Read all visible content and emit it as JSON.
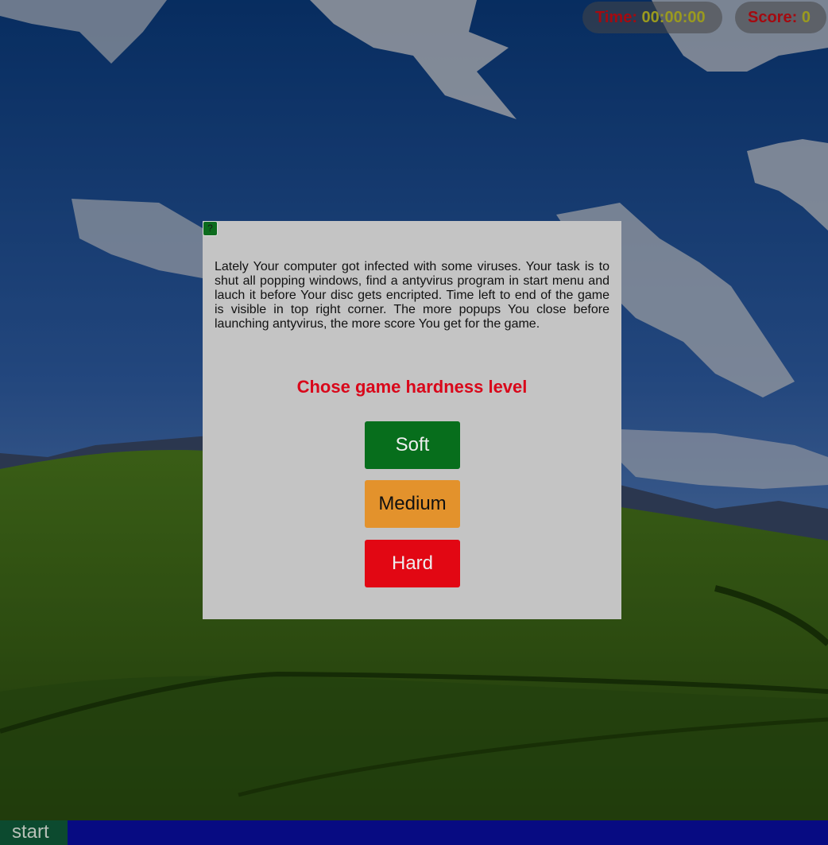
{
  "hud": {
    "time_label": "Time:",
    "time_value": "00:00:00",
    "score_label": "Score:",
    "score_value": "0"
  },
  "dialog": {
    "help_icon_glyph": "?",
    "intro_text": "Lately Your computer got infected with some viruses. Your task is to shut all popping windows, find a antyvirus program in start menu and lauch it before Your disc gets encripted. Time left to end of the game is visible in top right corner. The more popups You close before launching antyvirus, the more score You get for the game.",
    "heading": "Chose game hardness level",
    "levels": [
      {
        "label": "Soft",
        "color": "#076e1c"
      },
      {
        "label": "Medium",
        "color": "#e3922c"
      },
      {
        "label": "Hard",
        "color": "#e20713"
      }
    ]
  },
  "taskbar": {
    "start_label": "start",
    "color": "#070b82"
  },
  "colors": {
    "sky": "#2f5fa8",
    "hills": "#3f6a1a",
    "dialog_bg": "#c4c4c4",
    "heading": "#d9071a"
  }
}
